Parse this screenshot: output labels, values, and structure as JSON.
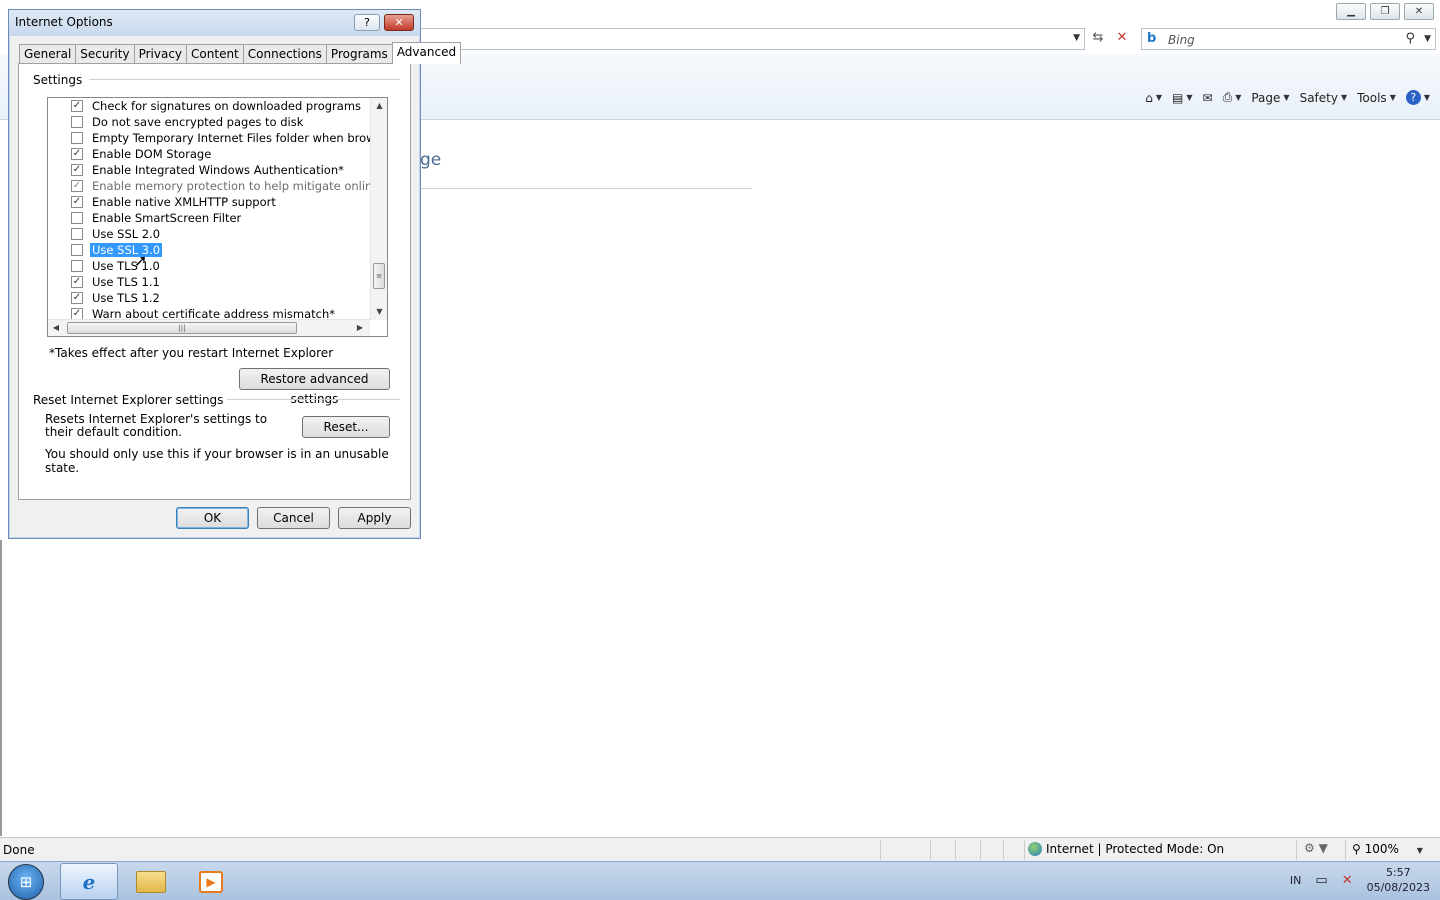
{
  "browser": {
    "search_engine": "Bing",
    "command_bar": {
      "page": "Page",
      "safety": "Safety",
      "tools": "Tools"
    },
    "heading_fragment": "ge",
    "status": "Done",
    "zone": "Internet | Protected Mode: On",
    "zoom": "100%"
  },
  "taskbar": {
    "language": "IN",
    "time": "5:57",
    "date": "05/08/2023"
  },
  "dialog": {
    "title": "Internet Options",
    "help_glyph": "?",
    "close_glyph": "✕",
    "tabs": [
      "General",
      "Security",
      "Privacy",
      "Content",
      "Connections",
      "Programs",
      "Advanced"
    ],
    "active_tab": "Advanced",
    "settings_group": "Settings",
    "items": [
      {
        "label": "Check for signatures on downloaded programs",
        "checked": true,
        "state": "normal"
      },
      {
        "label": "Do not save encrypted pages to disk",
        "checked": false,
        "state": "normal"
      },
      {
        "label": "Empty Temporary Internet Files folder when browser is clo",
        "checked": false,
        "state": "normal"
      },
      {
        "label": "Enable DOM Storage",
        "checked": true,
        "state": "normal"
      },
      {
        "label": "Enable Integrated Windows Authentication*",
        "checked": true,
        "state": "normal"
      },
      {
        "label": "Enable memory protection to help mitigate online attacks*",
        "checked": true,
        "state": "disabled"
      },
      {
        "label": "Enable native XMLHTTP support",
        "checked": true,
        "state": "normal"
      },
      {
        "label": "Enable SmartScreen Filter",
        "checked": false,
        "state": "normal"
      },
      {
        "label": "Use SSL 2.0",
        "checked": false,
        "state": "normal"
      },
      {
        "label": "Use SSL 3.0",
        "checked": false,
        "state": "selected"
      },
      {
        "label": "Use TLS 1.0",
        "checked": false,
        "state": "normal"
      },
      {
        "label": "Use TLS 1.1",
        "checked": true,
        "state": "normal"
      },
      {
        "label": "Use TLS 1.2",
        "checked": true,
        "state": "normal"
      },
      {
        "label": "Warn about certificate address mismatch*",
        "checked": true,
        "state": "normal"
      }
    ],
    "restart_note": "*Takes effect after you restart Internet Explorer",
    "restore_button": "Restore advanced settings",
    "reset_group": "Reset Internet Explorer settings",
    "reset_desc": "Resets Internet Explorer's settings to their default condition.",
    "reset_button": "Reset...",
    "reset_warning": "You should only use this if your browser is in an unusable state.",
    "ok": "OK",
    "cancel": "Cancel",
    "apply": "Apply"
  }
}
